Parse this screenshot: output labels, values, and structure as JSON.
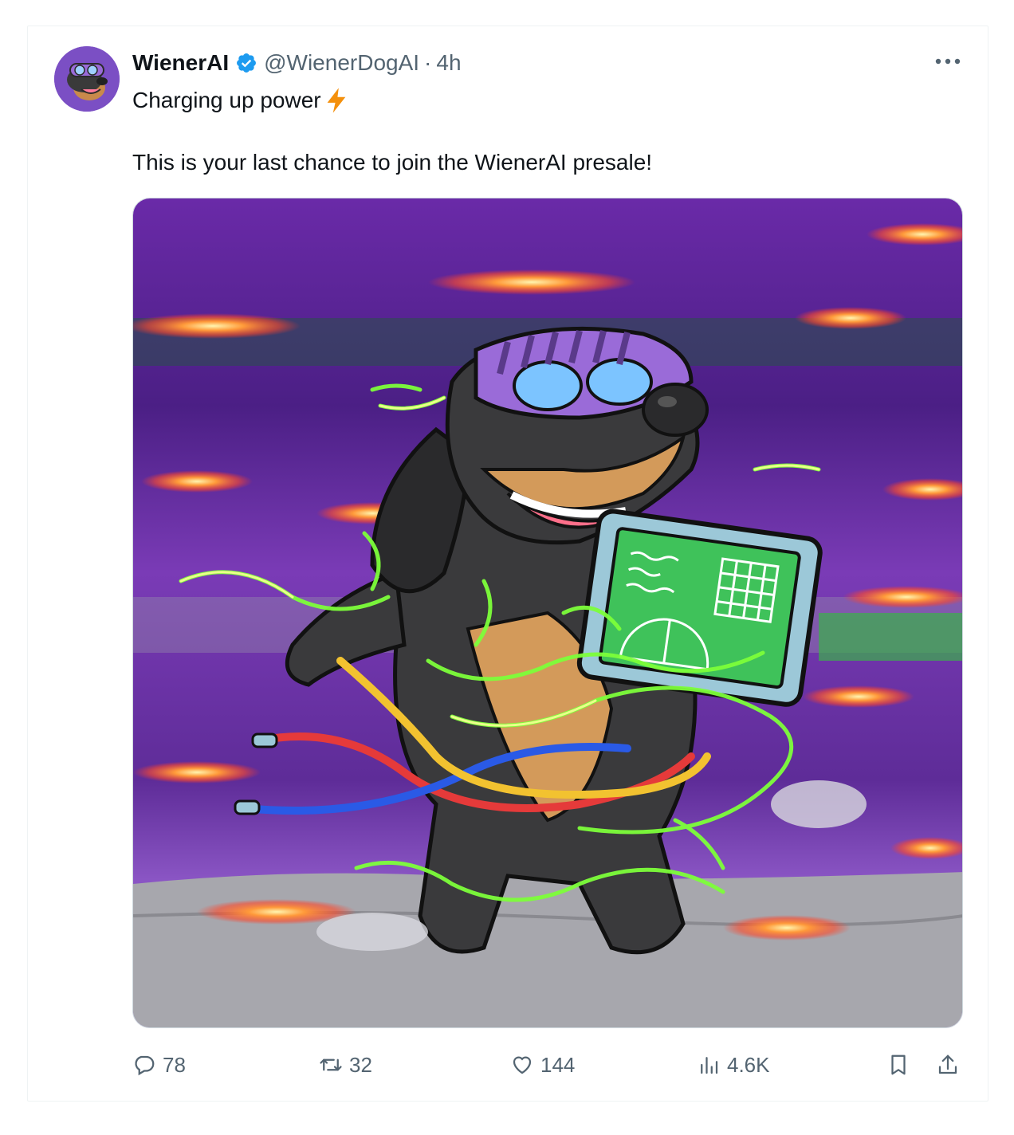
{
  "tweet": {
    "display_name": "WienerAI",
    "handle": "@WienerDogAI",
    "separator": "·",
    "time": "4h",
    "text_line1": "Charging up power",
    "text_line2": "This is your last chance to join the WienerAI presale!",
    "verified": true
  },
  "icons": {
    "avatar": "avatar-wiener-dog",
    "verified": "verified-badge-icon",
    "more": "more-icon",
    "bolt": "lightning-emoji",
    "reply": "reply-icon",
    "retweet": "retweet-icon",
    "like": "heart-icon",
    "views": "views-icon",
    "bookmark": "bookmark-icon",
    "share": "share-icon"
  },
  "stats": {
    "replies": "78",
    "retweets": "32",
    "likes": "144",
    "views": "4.6K"
  },
  "colors": {
    "verified_blue": "#1d9bf0",
    "secondary_text": "#536471",
    "primary_text": "#0f1419",
    "bolt_orange": "#f4900c"
  }
}
